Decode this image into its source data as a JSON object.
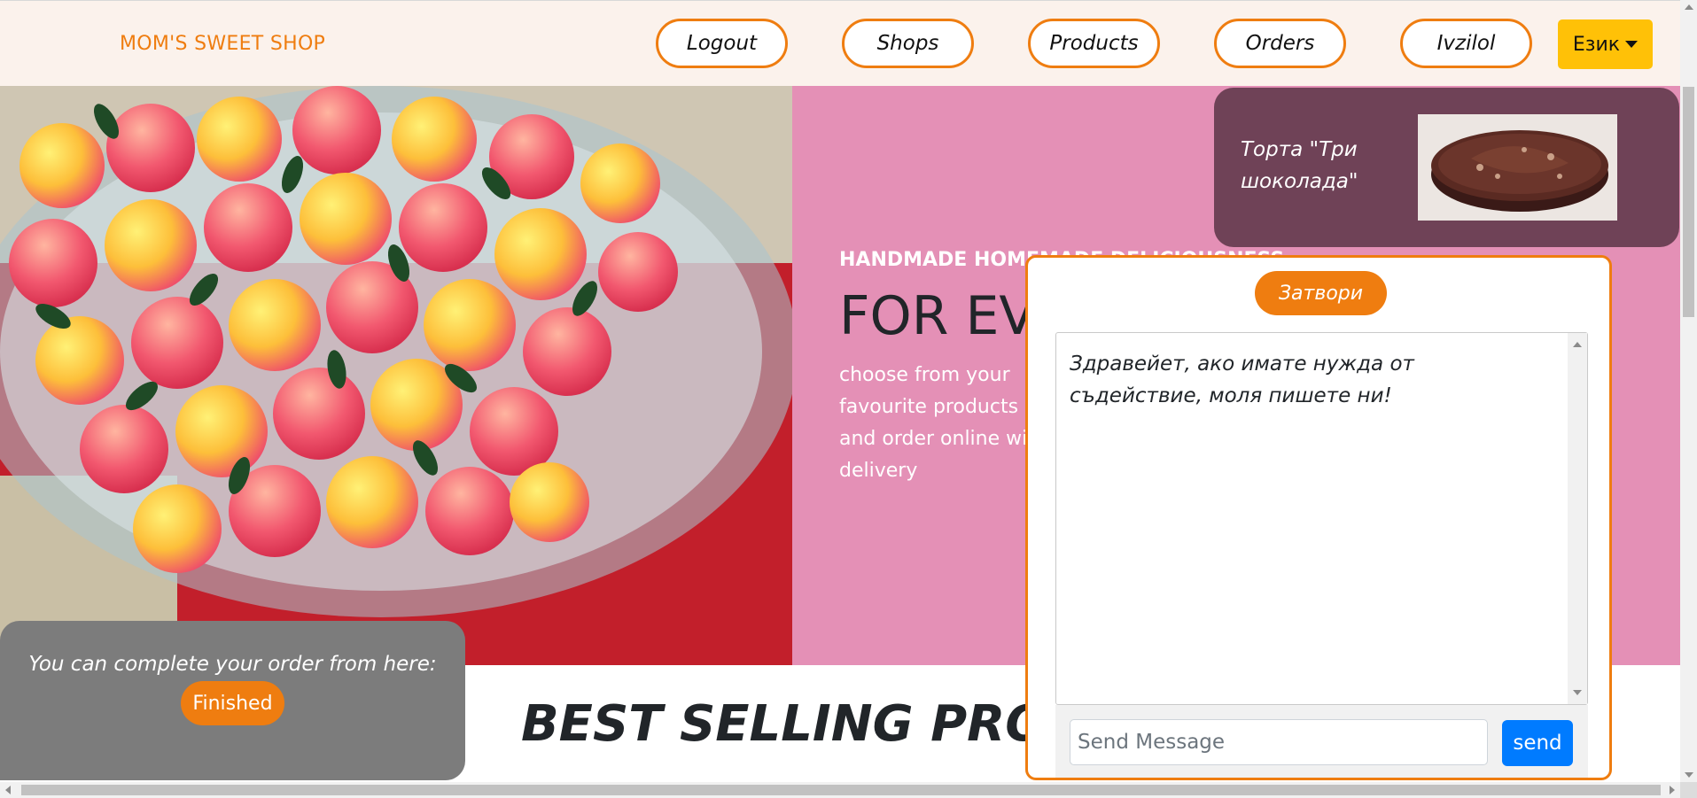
{
  "nav": {
    "brand": "MOM'S SWEET SHOP",
    "buttons": [
      "Logout",
      "Shops",
      "Products",
      "Orders",
      "Ivzilol"
    ],
    "language_label": "Език"
  },
  "hero": {
    "subtitle": "HANDMADE HOMEMADE DELICIOUSNESS",
    "title": "FOR EVERY OCCASION",
    "text": "choose from your favourite products and order online with delivery",
    "background_color": "#e490b6"
  },
  "product_card": {
    "name": "Торта \"Три шоколада\""
  },
  "best_selling": {
    "title": "BEST SELLING PRODUCTS"
  },
  "order_panel": {
    "text": "You can complete your order from here:",
    "button": "Finished"
  },
  "chat": {
    "close_label": "Затвори",
    "message": "Здравейет, ако имате нужда от съдействие, моля пишете ни!",
    "input_placeholder": "Send Message",
    "send_label": "send"
  },
  "colors": {
    "accent": "#ef7d10",
    "language_button": "#ffc107",
    "send_button": "#007bff",
    "product_card": "#6f4257"
  }
}
